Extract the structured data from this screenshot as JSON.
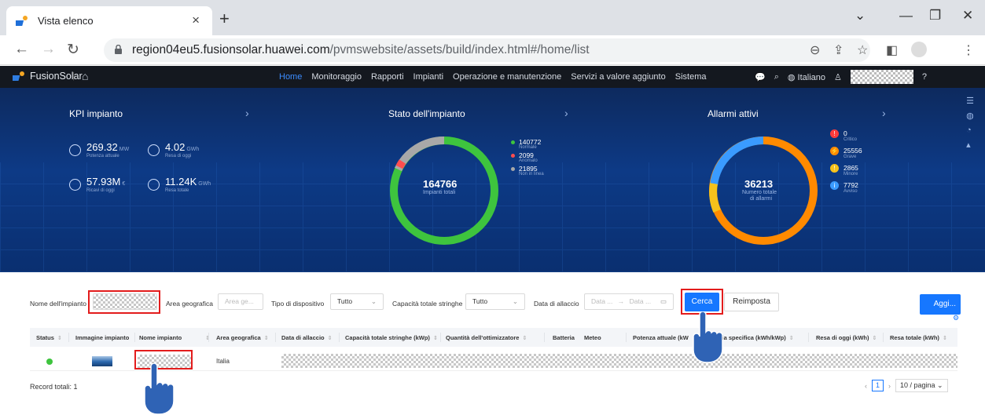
{
  "browser": {
    "tab_title": "Vista elenco",
    "tab_close": "×",
    "new_tab": "+",
    "url_host": "region04eu5.fusionsolar.huawei.com",
    "url_path": "/pvmswebsite/assets/build/index.html#/home/list"
  },
  "appnav": {
    "brand": "FusionSolar",
    "menu": [
      "Home",
      "Monitoraggio",
      "Rapporti",
      "Impianti",
      "Operazione e manutenzione",
      "Servizi a valore aggiunto",
      "Sistema"
    ],
    "language": "Italiano"
  },
  "kpi": {
    "title": "KPI impianto",
    "items": [
      {
        "value": "269.32",
        "unit": "MW",
        "label": "Potenza attuale"
      },
      {
        "value": "4.02",
        "unit": "GWh",
        "label": "Resa di oggi"
      },
      {
        "value": "57.93M",
        "unit": "€",
        "label": "Ricavi di oggi"
      },
      {
        "value": "11.24K",
        "unit": "GWh",
        "label": "Resa totale"
      }
    ]
  },
  "status": {
    "title": "Stato dell'impianto",
    "total": "164766",
    "total_label": "Impianti totali",
    "items": [
      {
        "value": "140772",
        "label": "Normale",
        "color": "#3ec43e"
      },
      {
        "value": "2099",
        "label": "Anomalo",
        "color": "#ff4d4f"
      },
      {
        "value": "21895",
        "label": "Non in linea",
        "color": "#a8a8a8"
      }
    ]
  },
  "alarms": {
    "title": "Allarmi attivi",
    "total": "36213",
    "total_label_1": "Numero totale",
    "total_label_2": "di allarmi",
    "items": [
      {
        "value": "0",
        "label": "Critico",
        "color": "#ff3b3b",
        "icon": "!"
      },
      {
        "value": "25556",
        "label": "Grave",
        "color": "#ff8a00",
        "icon": "⚡"
      },
      {
        "value": "2865",
        "label": "Minore",
        "color": "#f6c21b",
        "icon": "!"
      },
      {
        "value": "7792",
        "label": "Avviso",
        "color": "#3a9bff",
        "icon": "i"
      }
    ]
  },
  "filters": {
    "nome_impianto": "Nome dell'impianto",
    "area_geografica": "Area geografica",
    "area_placeholder": "Area ge...",
    "tipo_dispositivo": "Tipo di dispositivo",
    "tipo_value": "Tutto",
    "capacita": "Capacità totale stringhe",
    "capacita_value": "Tutto",
    "data_allaccio": "Data di allaccio",
    "data_from": "Data ...",
    "data_arrow": "→",
    "data_to": "Data ...",
    "cerca": "Cerca",
    "reimposta": "Reimposta",
    "aggiungi": "Aggi..."
  },
  "table": {
    "headers": [
      "Status",
      "Immagine impianto",
      "Nome impianto",
      "Area geografica",
      "Data di allaccio",
      "Capacità totale stringhe (kWp)",
      "Quantità dell'ottimizzatore",
      "Batteria",
      "Meteo",
      "Potenza attuale (kW)",
      "Energia specifica (kWh/kWp)",
      "Resa di oggi (kWh)",
      "Resa totale (kWh)"
    ],
    "header_visible": [
      "Status",
      "Immagine impianto",
      "Nome impianto",
      "Area geografica",
      "Data di allaccio",
      "Capacità totale stringhe (kWp)",
      "Quantità dell'ottimizzatore",
      "Batteria",
      "Meteo",
      "Potenza attuale (kW",
      "rgia specifica (kWh/kWp)",
      "Resa di oggi (kWh)",
      "Resa totale (kWh)"
    ],
    "row": {
      "area": "Italia"
    }
  },
  "footer": {
    "records": "Record totali: 1",
    "page": "1",
    "page_size": "10 / pagina"
  },
  "colors": {
    "accent": "#1677ff",
    "highlight_frame": "#e31c1c",
    "status_ok": "#3ec43e"
  }
}
